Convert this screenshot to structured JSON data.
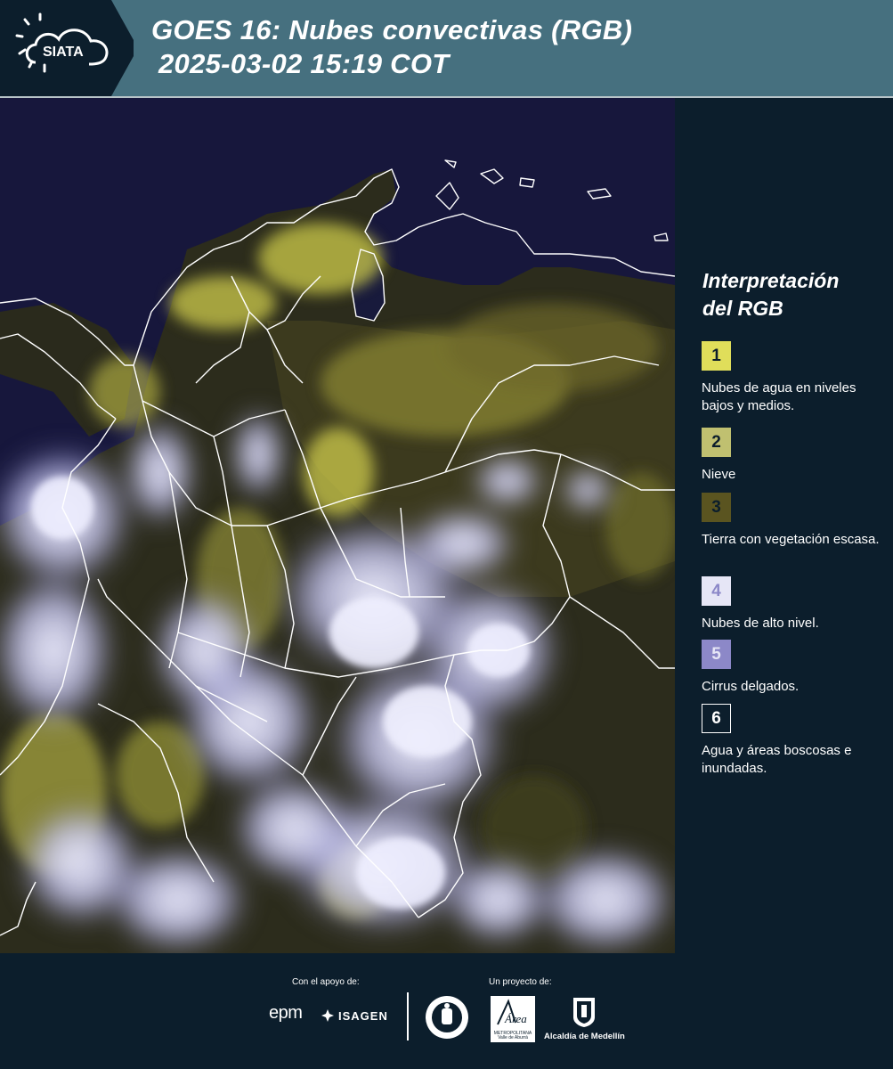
{
  "header": {
    "logo_text": "SIATA",
    "title_line1": "GOES 16: Nubes convectivas (RGB)",
    "title_line2": "2025-03-02 15:19 COT"
  },
  "legend": {
    "title_line1": "Interpretación",
    "title_line2": "del RGB",
    "items": [
      {
        "number": "1",
        "label": "Nubes de agua en niveles bajos y medios.",
        "color": "#e0de5a"
      },
      {
        "number": "2",
        "label": "Nieve",
        "color": "#c0c070"
      },
      {
        "number": "3",
        "label": "Tierra con vegetación escasa.",
        "color": "#5a5420"
      },
      {
        "number": "4",
        "label": "Nubes de alto nivel.",
        "color": "#e6e6f6"
      },
      {
        "number": "5",
        "label": "Cirrus delgados.",
        "color": "#8c88c8"
      },
      {
        "number": "6",
        "label": "Agua y áreas boscosas e inundadas.",
        "color": "#0c1e2c"
      }
    ]
  },
  "footer": {
    "support_caption": "Con el apoyo de:",
    "project_caption": "Un proyecto de:",
    "sponsors": [
      "epm",
      "ISAGEN"
    ],
    "partners": [
      "Área Metropolitana Valle de Aburrá",
      "Alcaldía de Medellín"
    ],
    "area_logo_text": "Área",
    "area_logo_sub": "METROPOLITANA Valle de Aburrá",
    "alcaldia_label": "Alcaldía de Medellín"
  },
  "colors": {
    "header_bg": "#46707f",
    "page_bg": "#0c1e2c",
    "ocean": "#15153a",
    "low_clouds": "#d8d650",
    "high_clouds": "#dcdcf6"
  }
}
